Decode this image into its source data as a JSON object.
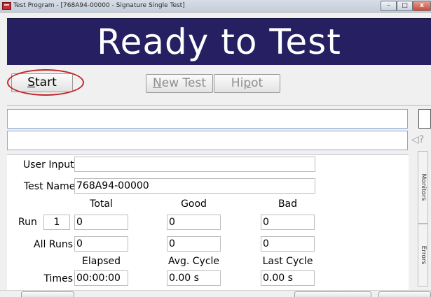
{
  "window": {
    "title": "Test Program - [768A94-00000 - Signature Single Test]",
    "controls": {
      "minimize": "–",
      "maximize": "□",
      "close": "x"
    }
  },
  "banner": {
    "status": "Ready to Test",
    "background": "#262062"
  },
  "toolbar": {
    "start_accel": "S",
    "start_rest": "tart",
    "new_test_accel": "N",
    "new_test_rest": "ew Test",
    "hipot_pre": "Hi",
    "hipot_accel": "p",
    "hipot_rest": "ot",
    "highlight_color": "#c32328"
  },
  "side_icons": "◁?",
  "form": {
    "user_input_label": "User Input",
    "user_input_value": "",
    "test_name_label": "Test Name",
    "test_name_value": "768A94-00000",
    "columns": [
      "Total",
      "Good",
      "Bad"
    ],
    "run_label": "Run",
    "run_number": "1",
    "run_values": [
      "0",
      "0",
      "0"
    ],
    "all_runs_label": "All Runs",
    "all_runs_values": [
      "0",
      "0",
      "0"
    ],
    "time_columns": [
      "Elapsed",
      "Avg. Cycle",
      "Last Cycle"
    ],
    "times_label": "Times",
    "times_values": [
      "00:00:00",
      "0.00 s",
      "0.00 s"
    ]
  },
  "side_tabs": {
    "monitors": "Monitors",
    "errors": "Errors"
  }
}
